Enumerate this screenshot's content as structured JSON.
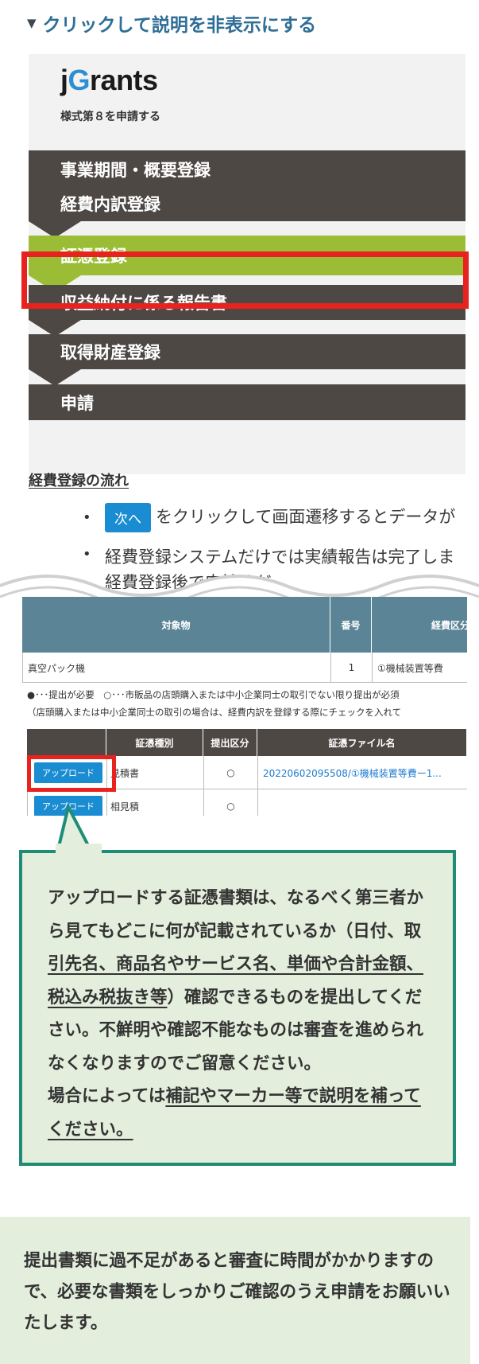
{
  "toggle": {
    "icon": "triangle-down-icon",
    "label": "クリックして説明を非表示にする"
  },
  "illustration_top": {
    "logo_prefix": "j",
    "logo_g": "G",
    "logo_suffix": "rants",
    "form_subtitle": "様式第８を申請する",
    "steps": [
      "事業期間・概要登録",
      "経費内訳登録",
      "証憑登録",
      "収益納付に係る報告書",
      "取得財産登録",
      "申請"
    ],
    "active_step_index": 2,
    "flow_title": "経費登録の流れ",
    "bullet1_button": "次へ",
    "bullet1_text": "をクリックして画面遷移するとデータが",
    "bullet2_text": "経費登録システムだけでは実績報告は完了しま",
    "bullet3_text": "経費登録後で申請くだ"
  },
  "illustration_table": {
    "header": {
      "col1": "対象物",
      "col2": "番号",
      "col3": "経費区分"
    },
    "row": {
      "name": "真空パック機",
      "number": "1",
      "category": "①機械装置等費"
    },
    "note1": "●･･･提出が必要　○･･･市販品の店頭購入または中小企業同士の取引でない限り提出が必須",
    "note2": "（店頭購入または中小企業同士の取引の場合は、経費内訳を登録する際にチェックを入れて",
    "sub_header": {
      "col1": "証憑種別",
      "col2": "提出区分",
      "col3": "証憑ファイル名"
    },
    "rows": [
      {
        "button": "アップロード",
        "type": "見積書",
        "mark": "○",
        "file": "20220602095508/①機械装置等費ー1..."
      },
      {
        "button": "アップロード",
        "type": "相見積",
        "mark": "○",
        "file": ""
      }
    ]
  },
  "callout": {
    "text1": "アップロードする証憑書類は、なるべく第三者から見てもどこに何が記載されているか（日付、取",
    "text_u1": "引先名、商品名やサービス名、単価や合計金額、",
    "text_u2": "税込み税抜き等",
    "text2": "）確認できるものを提出してください。不鮮明や確認不能なものは審査を進められなくなりますのでご留意ください。",
    "text3": "場合によっては",
    "text_u3": "補記やマーカー等で説明を補ってください。"
  },
  "footer": {
    "text": "提出書類に過不足があると審査に時間がかかりますので、必要な書類をしっかりご確認のうえ申請をお願いいたします。"
  },
  "colors": {
    "accent_blue": "#2f6e96",
    "step_dark": "#4e4845",
    "step_active": "#9bbd35",
    "highlight_red": "#e8231f",
    "callout_border": "#1f8c78",
    "callout_bg": "#e3eedc"
  }
}
